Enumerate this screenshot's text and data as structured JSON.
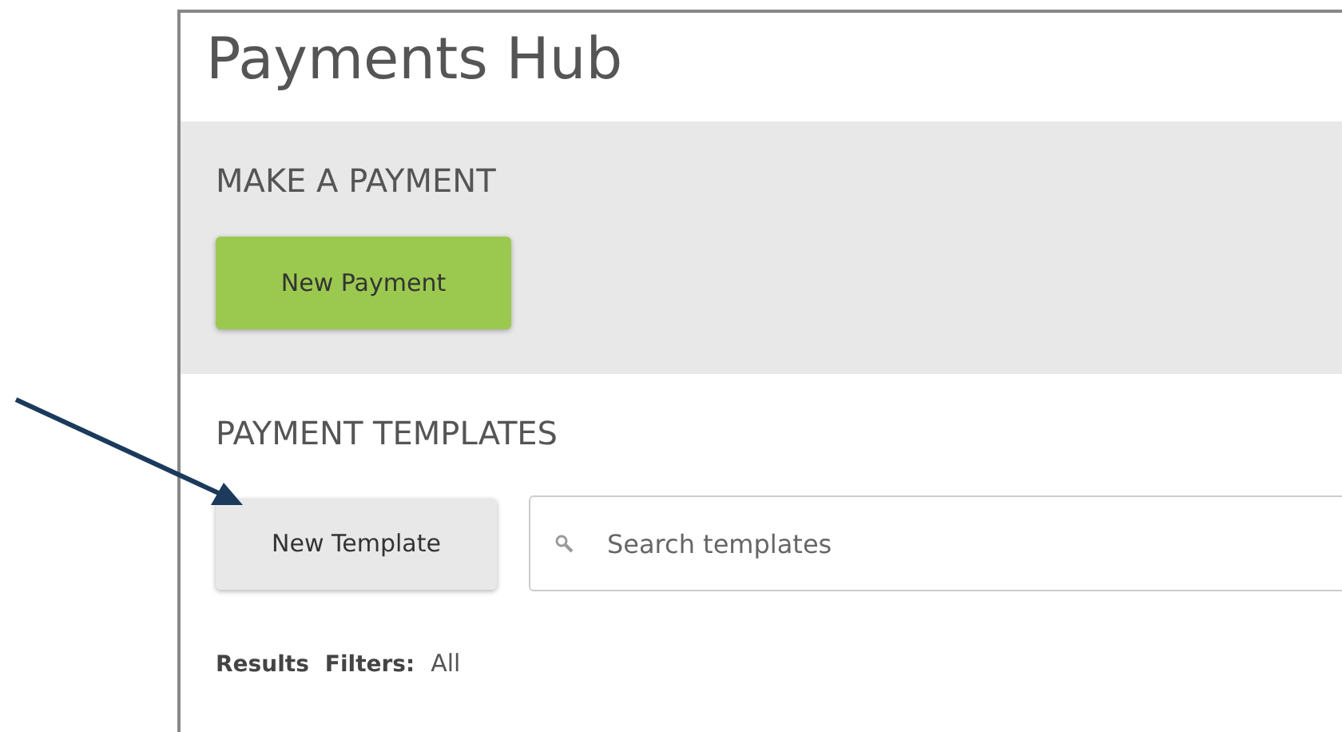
{
  "title": "Payments Hub",
  "make_payment": {
    "heading": "MAKE A PAYMENT",
    "button": "New Payment"
  },
  "templates": {
    "heading": "PAYMENT TEMPLATES",
    "button": "New Template",
    "search": {
      "placeholder": "Search templates"
    }
  },
  "results": {
    "label": "Results",
    "filters_label": "Filters:",
    "filter_value": "All"
  }
}
